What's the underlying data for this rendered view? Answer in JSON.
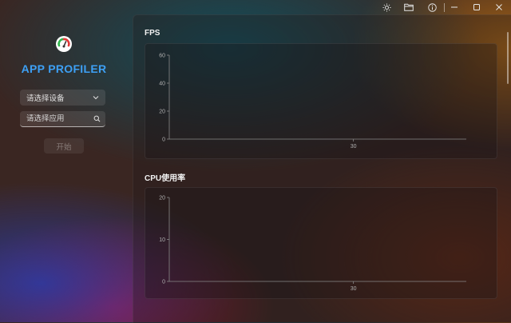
{
  "titlebar": {
    "icons": [
      "sun-icon",
      "folder-icon",
      "info-icon",
      "minimize-icon",
      "maximize-icon",
      "close-icon"
    ]
  },
  "sidebar": {
    "app_title": "APP PROFILER",
    "device_select": {
      "value": "请选择设备"
    },
    "app_search": {
      "placeholder": "请选择应用"
    },
    "start_button": "开始"
  },
  "colors": {
    "accent": "#3da0f5",
    "logo_green": "#2fb84d",
    "logo_red": "#e03a3a",
    "axis": "#8a8a8a"
  },
  "charts": {
    "fps_title": "FPS",
    "cpu_title": "CPU使用率"
  },
  "chart_data": [
    {
      "type": "line",
      "title": "FPS",
      "ylim": [
        0,
        60
      ],
      "y_ticks": [
        "0",
        "20",
        "40",
        "60"
      ],
      "x_ticks": [
        "30"
      ],
      "series": []
    },
    {
      "type": "line",
      "title": "CPU使用率",
      "ylim": [
        0,
        20
      ],
      "y_ticks": [
        "0",
        "10",
        "20"
      ],
      "x_ticks": [
        "30"
      ],
      "series": []
    }
  ]
}
